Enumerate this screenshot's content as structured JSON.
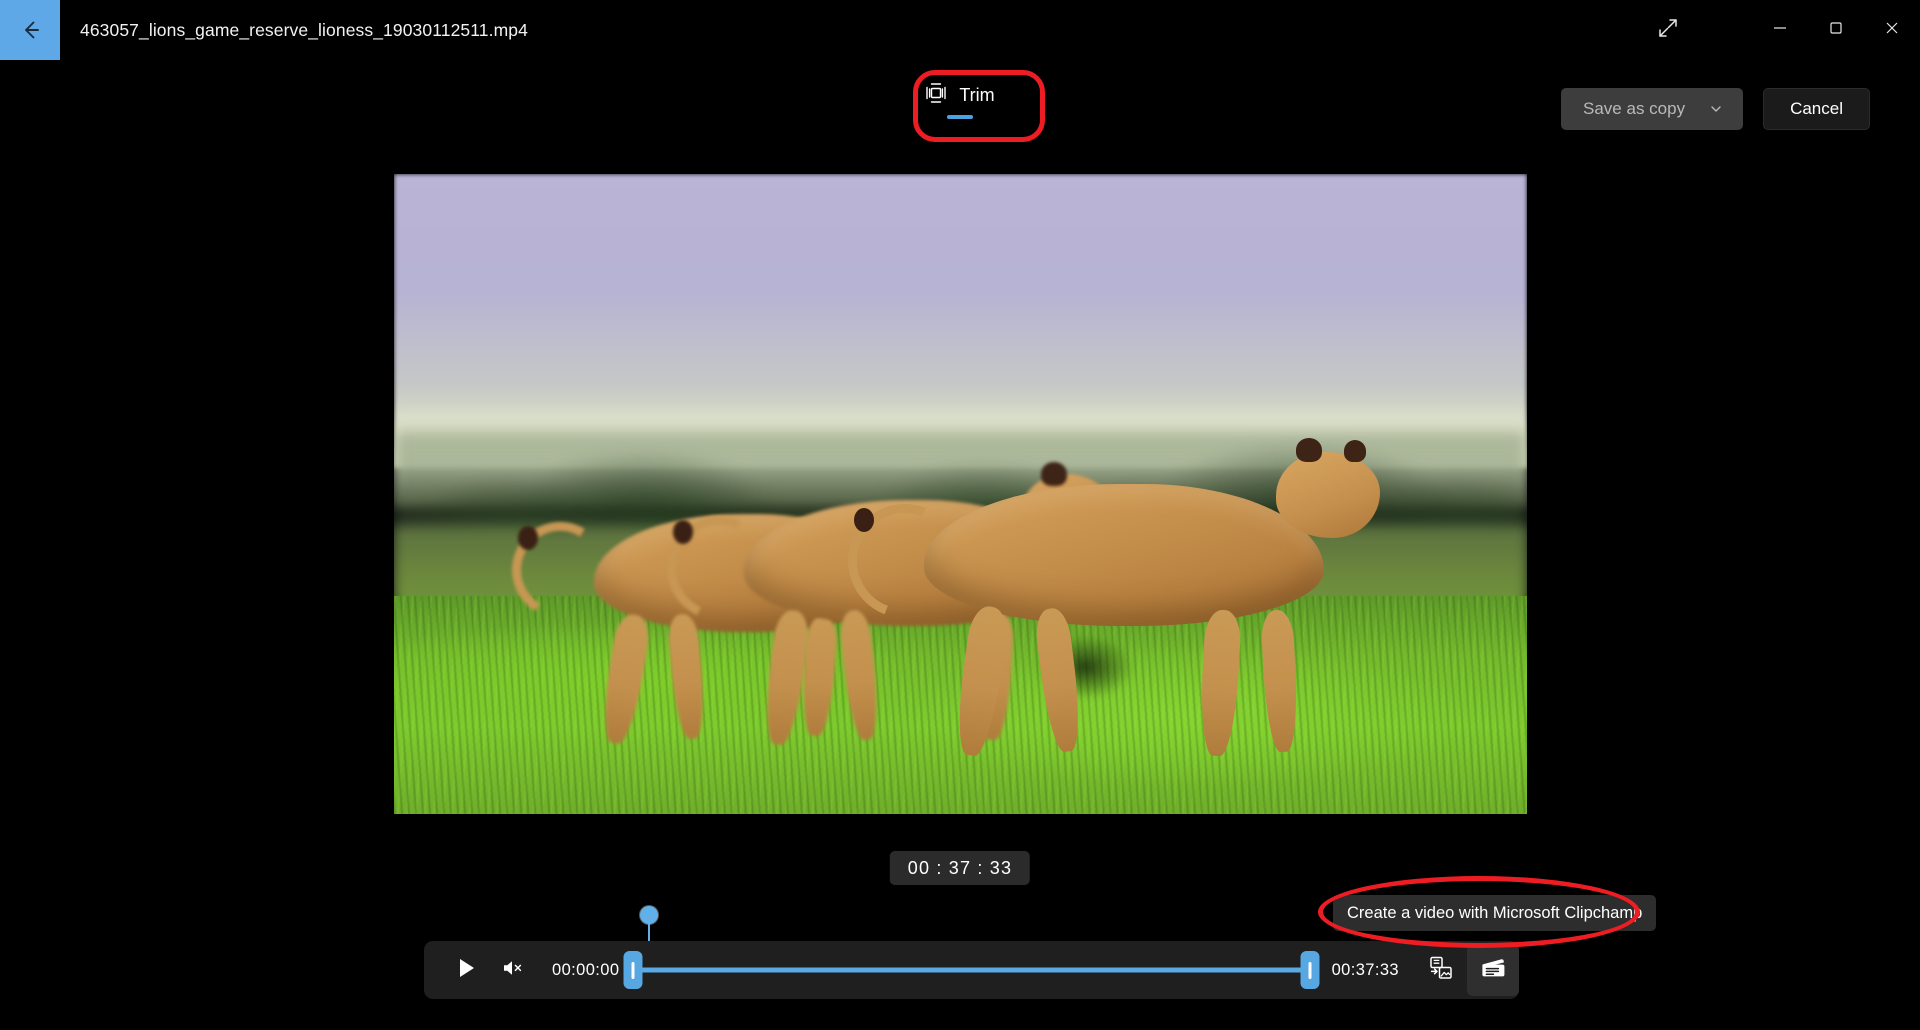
{
  "window": {
    "file_title": "463057_lions_game_reserve_lioness_19030112511.mp4",
    "back_icon": "back-arrow-icon",
    "expand_icon": "expand-diagonal-icon",
    "minimize_icon": "minimize-icon",
    "maximize_icon": "maximize-restore-icon",
    "close_icon": "close-icon"
  },
  "tabs": [
    {
      "label": "Trim",
      "icon": "trim-icon",
      "selected": true
    }
  ],
  "actions": {
    "save_label": "Save as copy",
    "save_chevron_icon": "chevron-down-icon",
    "cancel_label": "Cancel"
  },
  "player": {
    "time_chip": "00 : 37 : 33",
    "current_time": "00:00:00",
    "duration": "00:37:33",
    "play_icon": "play-icon",
    "mute_icon": "speaker-muted-icon",
    "save_frame_icon": "save-frame-as-photo-icon",
    "clipchamp_icon": "clapperboard-icon",
    "trim_start_percent": 0,
    "trim_end_percent": 100,
    "playhead_percent": 0
  },
  "tooltip": {
    "text": "Create a video with Microsoft Clipchamp"
  },
  "annotations": {
    "accent_red": "#ee1d23",
    "accent_blue": "#4aa3e0",
    "back_button_blue": "#5fa8e8"
  }
}
